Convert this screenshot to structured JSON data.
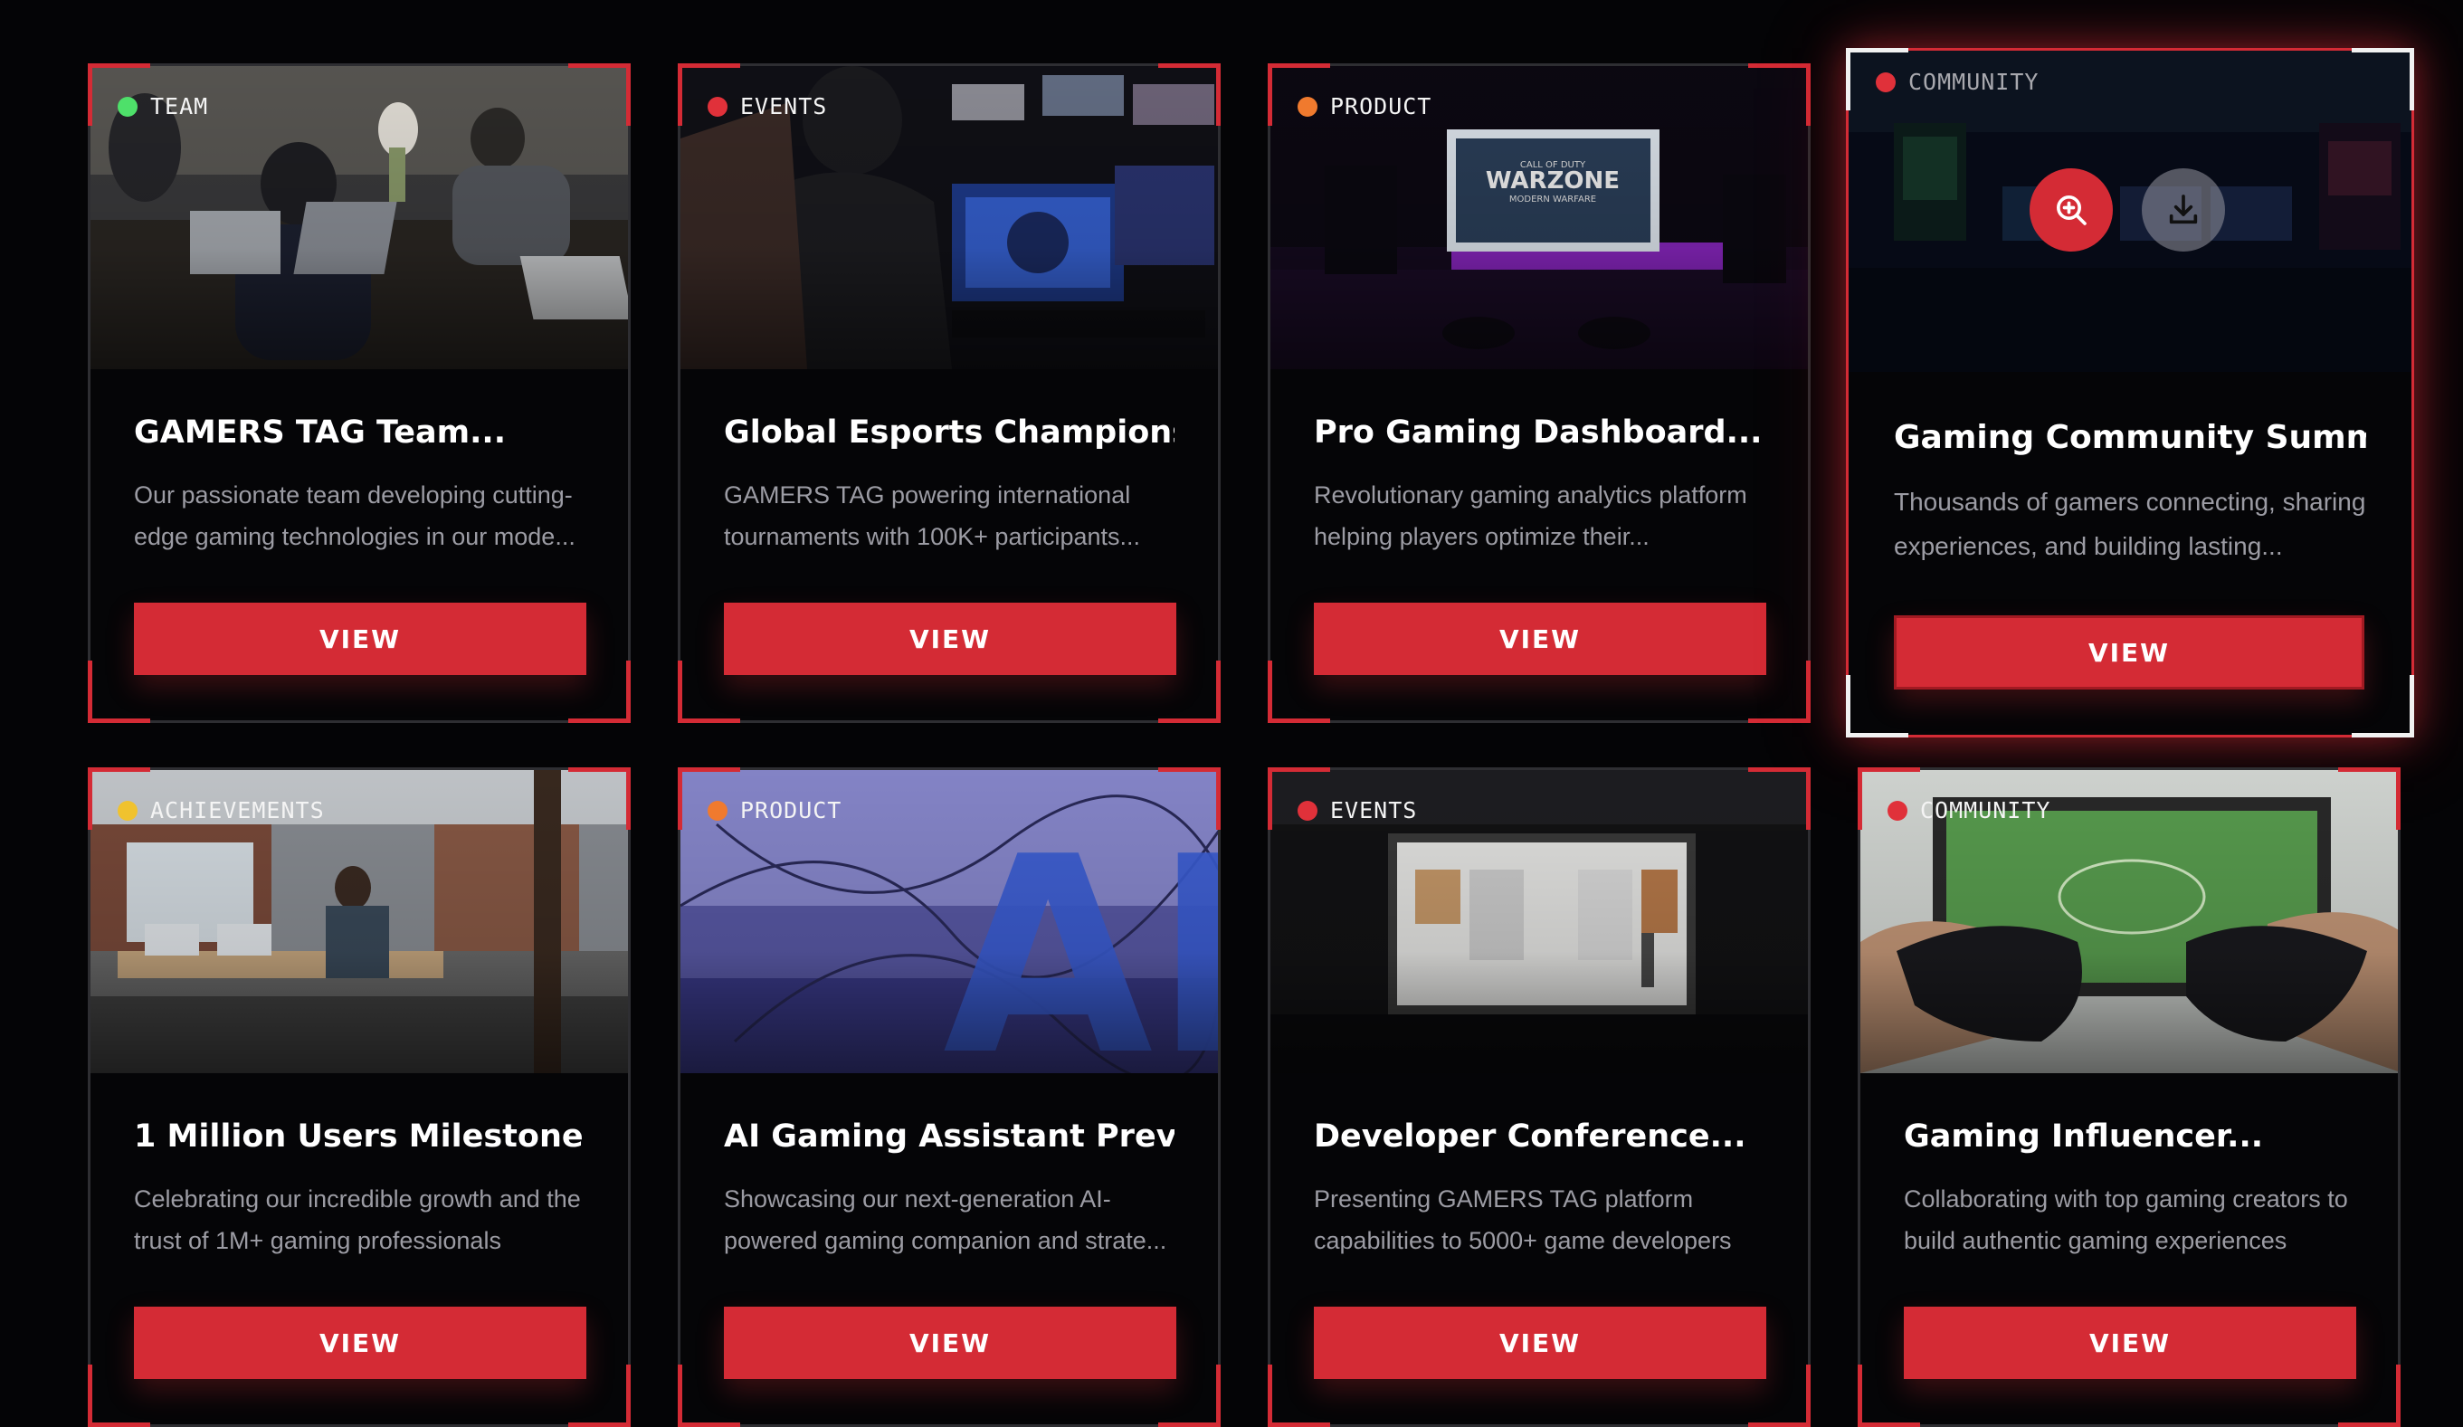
{
  "colors": {
    "accent": "#d42b35",
    "background": "#040406",
    "border": "#2e2e32",
    "team": "#4ee06a",
    "events": "#e0313a",
    "product": "#f07a2e",
    "community": "#e0313a",
    "achievements": "#f0c22e"
  },
  "cards": [
    {
      "category": "TEAM",
      "category_color": "#4ee06a",
      "title": "GAMERS TAG Team...",
      "description": "Our passionate team developing cutting-edge gaming technologies in our mode...",
      "button": "VIEW",
      "image": "team-working-on-laptops"
    },
    {
      "category": "EVENTS",
      "category_color": "#e0313a",
      "title": "Global Esports Championship",
      "description": "GAMERS TAG powering international tournaments with 100K+ participants...",
      "button": "VIEW",
      "image": "esports-player-at-monitors"
    },
    {
      "category": "PRODUCT",
      "category_color": "#f07a2e",
      "title": "Pro Gaming Dashboard...",
      "description": "Revolutionary gaming analytics platform helping players optimize their...",
      "button": "VIEW",
      "image": "gaming-setup-warzone",
      "screen_text": "CALL OF DUTY WARZONE MODERN WARFARE"
    },
    {
      "category": "COMMUNITY",
      "category_color": "#e0313a",
      "title": "Gaming Community Summit",
      "description": "Thousands of gamers connecting, sharing experiences, and building lasting...",
      "button": "VIEW",
      "image": "arcade-room",
      "active": true,
      "overlay_actions": [
        "zoom-in-icon",
        "download-icon"
      ]
    },
    {
      "category": "ACHIEVEMENTS",
      "category_color": "#f0c22e",
      "title": "1 Million Users Milestone",
      "description": "Celebrating our incredible growth and the trust of 1M+ gaming professionals",
      "button": "VIEW",
      "image": "loft-office"
    },
    {
      "category": "PRODUCT",
      "category_color": "#f07a2e",
      "title": "AI Gaming Assistant Preview",
      "description": "Showcasing our next-generation AI-powered gaming companion and strate...",
      "button": "VIEW",
      "image": "ai-letters-3d",
      "image_text": "AI"
    },
    {
      "category": "EVENTS",
      "category_color": "#e0313a",
      "title": "Developer Conference...",
      "description": "Presenting GAMERS TAG platform capabilities to 5000+ game developers",
      "button": "VIEW",
      "image": "conference-stage"
    },
    {
      "category": "COMMUNITY",
      "category_color": "#e0313a",
      "title": "Gaming Influencer...",
      "description": "Collaborating with top gaming creators to build authentic gaming experiences",
      "button": "VIEW",
      "image": "controllers-football-game"
    }
  ]
}
